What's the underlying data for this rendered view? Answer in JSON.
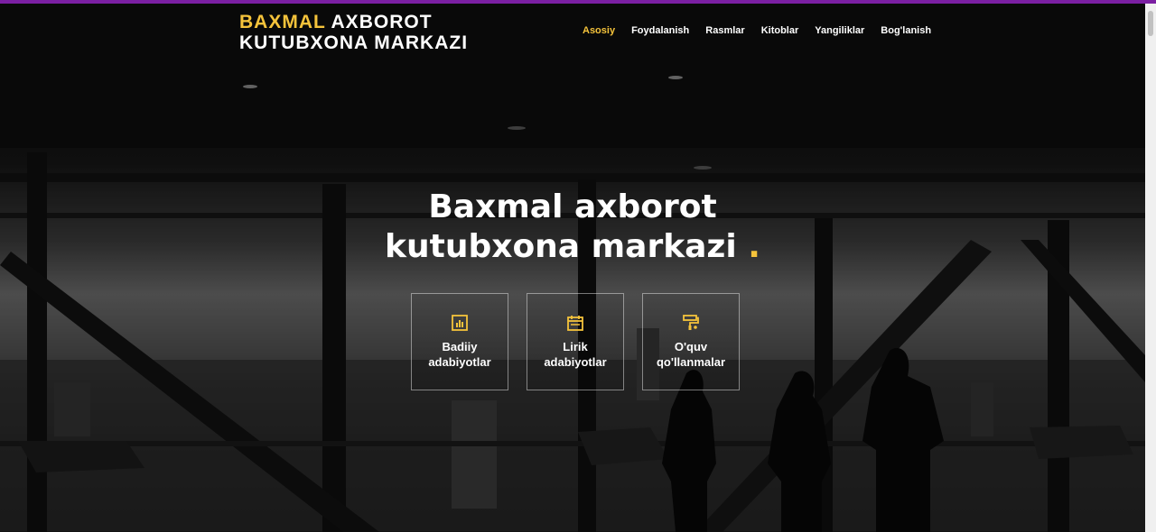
{
  "header": {
    "logo_highlight": "BAXMAL",
    "logo_rest_line1": "AXBOROT",
    "logo_line2": "KUTUBXONA MARKAZI"
  },
  "nav": {
    "items": [
      {
        "label": "Asosiy",
        "active": true
      },
      {
        "label": "Foydalanish"
      },
      {
        "label": "Rasmlar"
      },
      {
        "label": "Kitoblar"
      },
      {
        "label": "Yangiliklar"
      },
      {
        "label": "Bog'lanish"
      }
    ]
  },
  "hero": {
    "title_line1": "Baxmal axborot",
    "title_line2": "kutubxona markazi",
    "title_dot": "."
  },
  "cards": [
    {
      "line1": "Badiiy",
      "line2": "adabiyotlar",
      "icon": "bar-chart-icon"
    },
    {
      "line1": "Lirik",
      "line2": "adabiyotlar",
      "icon": "calendar-icon"
    },
    {
      "line1": "O'quv",
      "line2": "qo'llanmalar",
      "icon": "paint-roller-icon"
    }
  ],
  "colors": {
    "accent": "#f5c33b",
    "top_bar": "#7b1fa2"
  }
}
